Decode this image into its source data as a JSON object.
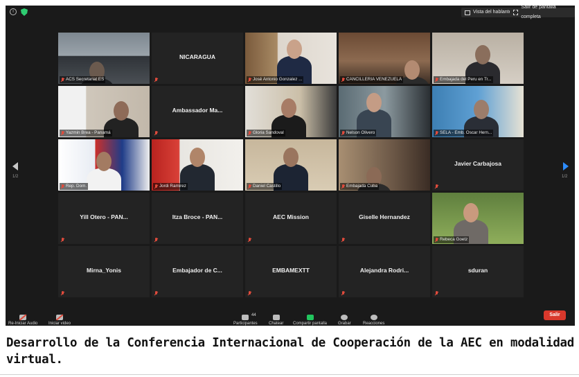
{
  "topbar": {
    "info_icon": "info-icon",
    "shield_icon": "shield-icon",
    "speaker_view_label": "Vista del hablante",
    "exit_fullscreen_label": "Salir de pantalla completa"
  },
  "pagination": {
    "left": "1/2",
    "right": "1/2"
  },
  "participants": [
    {
      "name": "ACS Secretariat ES",
      "video": true,
      "active": true
    },
    {
      "name": "NICARAGUA",
      "video": false
    },
    {
      "name": "José Antonio Gonzalez ...",
      "video": true
    },
    {
      "name": "CANCILLERIA VENEZUELA",
      "video": true
    },
    {
      "name": "Embajada del Peru en Tr...",
      "video": true
    },
    {
      "name": "Yazmin Brea - Panamá",
      "video": true
    },
    {
      "name": "Ambassador Ma...",
      "video": false
    },
    {
      "name": "Gloria Sandoval",
      "video": true
    },
    {
      "name": "Nelson Olivero",
      "video": true
    },
    {
      "name": "SELA - Emb. Oscar Hern...",
      "video": true
    },
    {
      "name": "Rep. Dom.",
      "video": true
    },
    {
      "name": "Jordi Ramirez",
      "video": true
    },
    {
      "name": "Daniel Castillo",
      "video": true
    },
    {
      "name": "Embajada Cuba",
      "video": true
    },
    {
      "name": "Javier Carbajosa",
      "video": false
    },
    {
      "name": "Yill Otero  - PAN...",
      "video": false
    },
    {
      "name": "Itza Broce - PAN...",
      "video": false
    },
    {
      "name": "AEC Mission",
      "video": false
    },
    {
      "name": "Giselle Hernandez",
      "video": false
    },
    {
      "name": "Rebeca Goetz",
      "video": true
    },
    {
      "name": "Mirna_Yonis",
      "video": false
    },
    {
      "name": "Embajador de C...",
      "video": false
    },
    {
      "name": "EMBAMEXTT",
      "video": false
    },
    {
      "name": "Alejandra  Rodri...",
      "video": false
    },
    {
      "name": "sduran",
      "video": false
    }
  ],
  "toolbar": {
    "audio_label": "Re-Iniciar Audio",
    "video_label": "Iniciar video",
    "participants_label": "Participantes",
    "participants_count": "44",
    "chat_label": "Chatear",
    "share_label": "Compartir pantalla",
    "record_label": "Grabar",
    "reactions_label": "Reacciones",
    "leave_label": "Salir"
  },
  "caption": "Desarrollo de la Conferencia Internacional de Cooperación de la AEC en modalidad virtual."
}
